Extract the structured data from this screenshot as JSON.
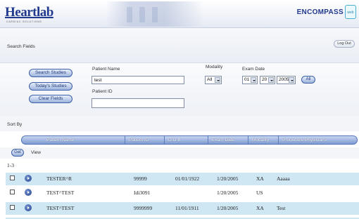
{
  "header": {
    "logo": "Heartlab",
    "logo_sub": "CARDIAC SOLUTIONS",
    "brand": "ENCOMPASS",
    "brand_badge": "web"
  },
  "search_fields_label": "Search Fields",
  "logout_label": "Log Out",
  "buttons": {
    "search_studies": "Search Studies",
    "todays_studies": "Today's Studies",
    "clear_fields": "Clear Fields",
    "all": "All",
    "get": "Get"
  },
  "form": {
    "patient_name_label": "Patient Name",
    "patient_name_value": "test",
    "patient_id_label": "Patient ID",
    "patient_id_value": "",
    "modality_label": "Modality",
    "modality_value": "All",
    "exam_date_label": "Exam Date",
    "exam_month": "01",
    "exam_day": "20",
    "exam_year": "2005"
  },
  "sort_by_label": "Sort By",
  "view_label": "View",
  "columns": [
    "Patient Name",
    "Patient ID",
    "D.O.B.",
    "Exam Date",
    "Modality",
    "Procedure Physicians"
  ],
  "range": "1-3",
  "rows": [
    {
      "name": "TESTER^R",
      "id": "99999",
      "dob": "01/01/1922",
      "exam": "1/20/2005",
      "modality": "XA",
      "physician": "Aaaaa"
    },
    {
      "name": "TEST^TEST",
      "id": "Idi3091",
      "dob": "",
      "exam": "1/20/2005",
      "modality": "US",
      "physician": ""
    },
    {
      "name": "TEST^TEST",
      "id": "9999999",
      "dob": "11/01/1911",
      "exam": "1/20/2005",
      "modality": "XA",
      "physician": "Test"
    }
  ]
}
